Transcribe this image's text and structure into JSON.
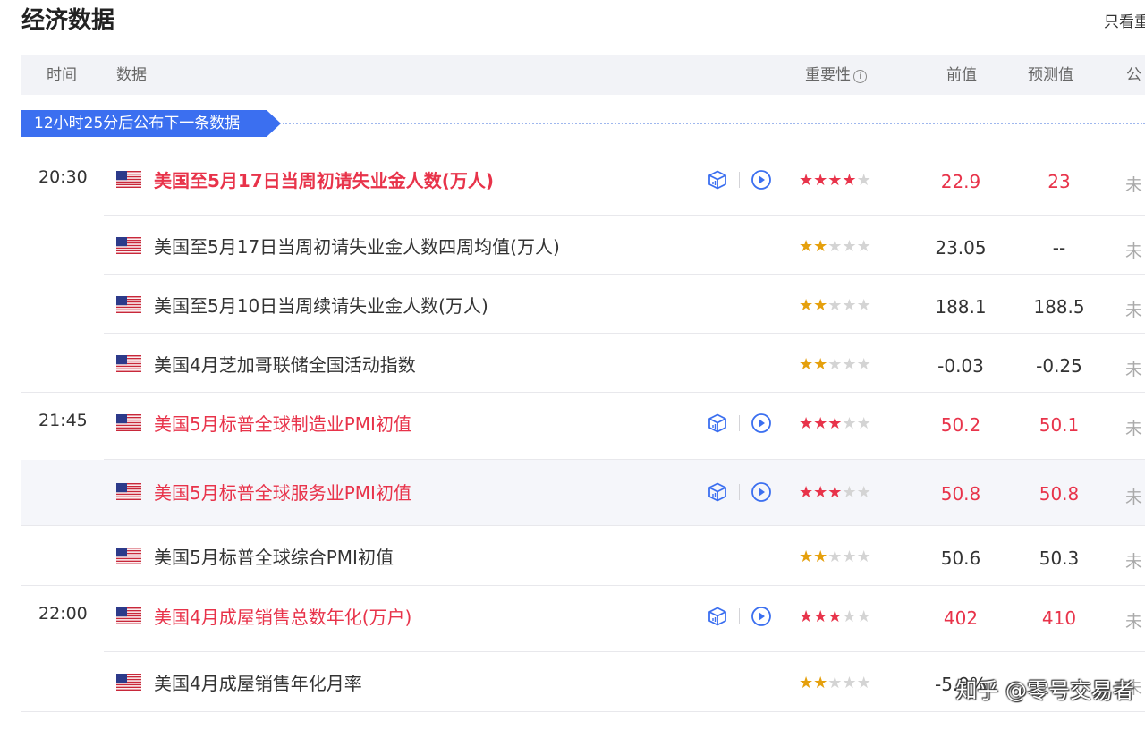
{
  "page_title": "经济数据",
  "only_important_label": "只看重",
  "header": {
    "time": "时间",
    "data": "数据",
    "importance": "重要性",
    "previous": "前值",
    "forecast": "预测值",
    "published": "公"
  },
  "banner": "12小时25分后公布下一条数据",
  "rows": [
    {
      "time": "20:30",
      "name": "美国至5月17日当周初请失业金人数(万人)",
      "stars": 4,
      "highlight": false,
      "red": true,
      "bold": true,
      "has_actions": true,
      "previous": "22.9",
      "forecast": "23",
      "status": "未"
    },
    {
      "time": "",
      "name": "美国至5月17日当周初请失业金人数四周均值(万人)",
      "stars": 2,
      "highlight": false,
      "red": false,
      "bold": false,
      "has_actions": false,
      "previous": "23.05",
      "forecast": "--",
      "status": "未"
    },
    {
      "time": "",
      "name": "美国至5月10日当周续请失业金人数(万人)",
      "stars": 2,
      "highlight": false,
      "red": false,
      "bold": false,
      "has_actions": false,
      "previous": "188.1",
      "forecast": "188.5",
      "status": "未"
    },
    {
      "time": "",
      "name": "美国4月芝加哥联储全国活动指数",
      "stars": 2,
      "highlight": false,
      "red": false,
      "bold": false,
      "has_actions": false,
      "previous": "-0.03",
      "forecast": "-0.25",
      "status": "未"
    },
    {
      "time": "21:45",
      "name": "美国5月标普全球制造业PMI初值",
      "stars": 3,
      "highlight": false,
      "red": true,
      "bold": false,
      "has_actions": true,
      "previous": "50.2",
      "forecast": "50.1",
      "status": "未"
    },
    {
      "time": "",
      "name": "美国5月标普全球服务业PMI初值",
      "stars": 3,
      "highlight": true,
      "red": true,
      "bold": false,
      "has_actions": true,
      "previous": "50.8",
      "forecast": "50.8",
      "status": "未"
    },
    {
      "time": "",
      "name": "美国5月标普全球综合PMI初值",
      "stars": 2,
      "highlight": false,
      "red": false,
      "bold": false,
      "has_actions": false,
      "previous": "50.6",
      "forecast": "50.3",
      "status": "未"
    },
    {
      "time": "22:00",
      "name": "美国4月成屋销售总数年化(万户)",
      "stars": 3,
      "highlight": false,
      "red": true,
      "bold": false,
      "has_actions": true,
      "previous": "402",
      "forecast": "410",
      "status": "未"
    },
    {
      "time": "",
      "name": "美国4月成屋销售年化月率",
      "stars": 2,
      "highlight": false,
      "red": false,
      "bold": false,
      "has_actions": false,
      "previous": "-5.9%",
      "forecast": "",
      "status": "未"
    }
  ],
  "watermark": "知乎 @零号交易者",
  "colors": {
    "accent": "#3b6ff0",
    "red": "#e8334a",
    "gold": "#e5a00d",
    "header_bg": "#f2f3f7"
  }
}
